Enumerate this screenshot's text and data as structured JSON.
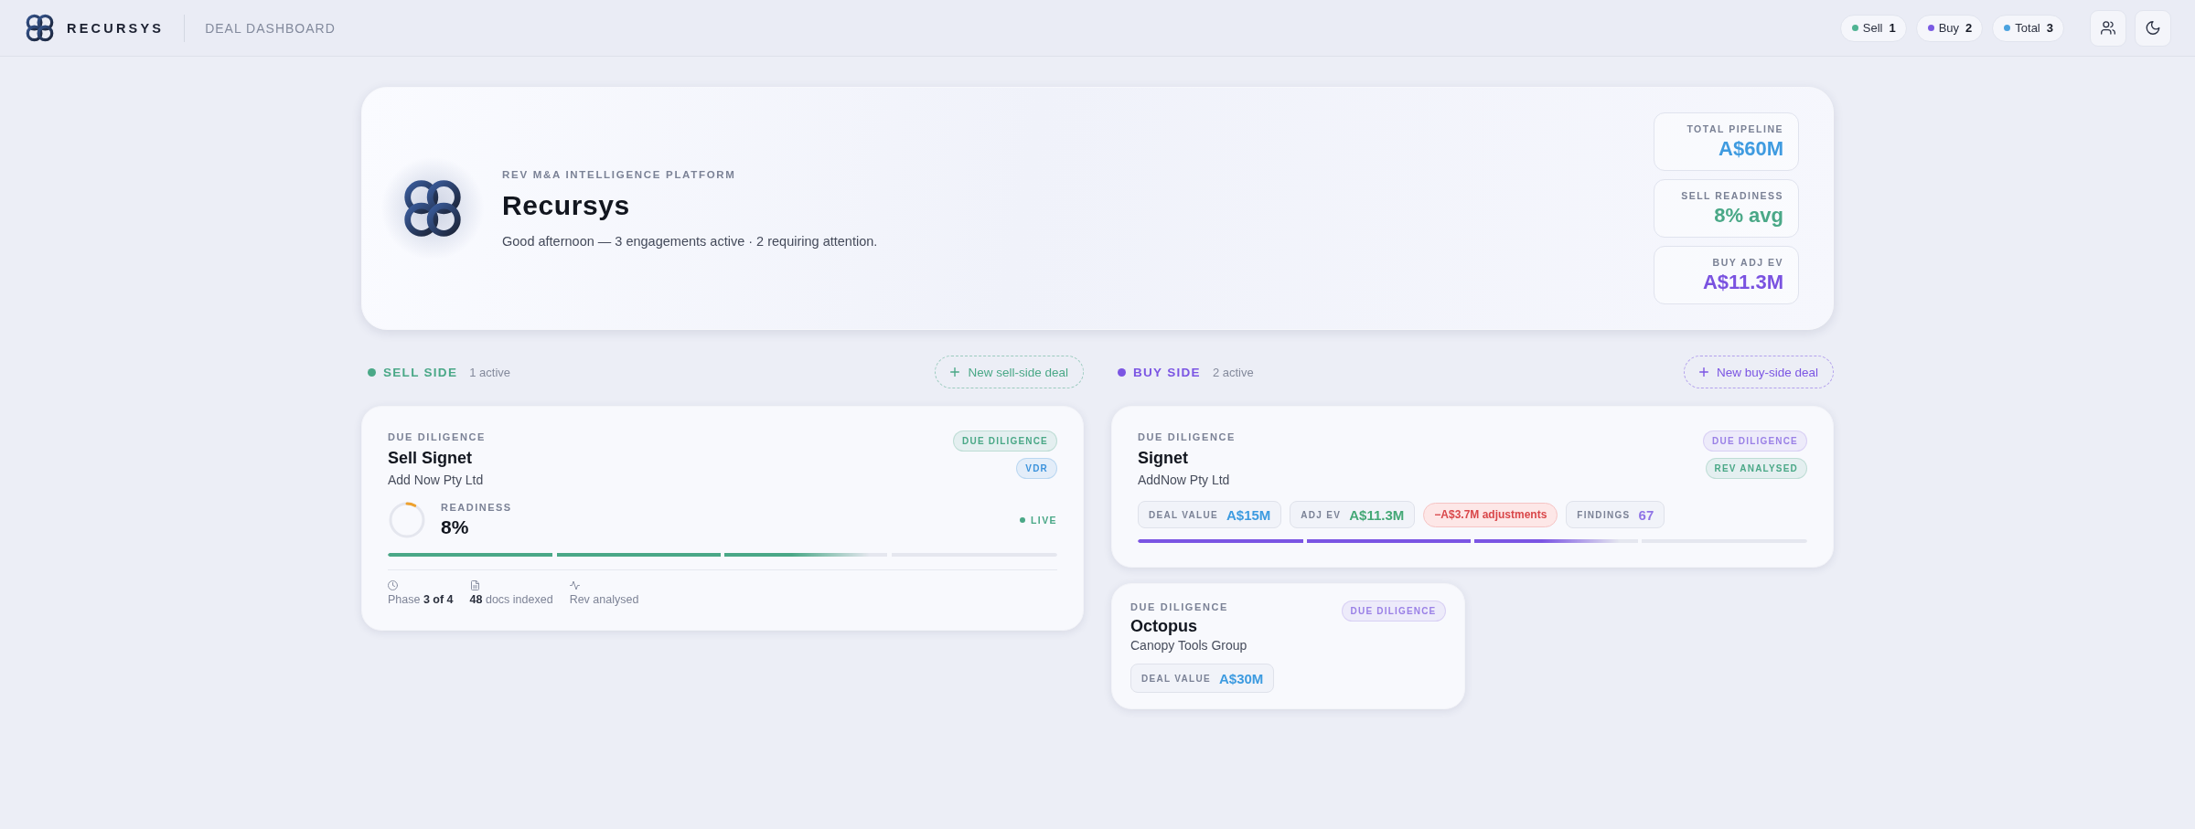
{
  "top_bar": {
    "brand": "RECURSYS",
    "page_title": "DEAL DASHBOARD",
    "counters": [
      {
        "label": "Sell",
        "count": "1",
        "color": "#4fb393"
      },
      {
        "label": "Buy",
        "count": "2",
        "color": "#7a5ae3"
      },
      {
        "label": "Total",
        "count": "3",
        "color": "#4aa2df"
      }
    ]
  },
  "hero": {
    "eyebrow": "REV M&A INTELLIGENCE PLATFORM",
    "title": "Recursys",
    "greeting": "Good afternoon — 3 engagements active · 2 requiring attention.",
    "stats": [
      {
        "label": "TOTAL PIPELINE",
        "value": "A$60M",
        "color": "#3f9be0"
      },
      {
        "label": "SELL READINESS",
        "value": "8% avg",
        "color": "#4aa887"
      },
      {
        "label": "BUY ADJ EV",
        "value": "A$11.3M",
        "color": "#7a52e0"
      }
    ]
  },
  "sections": [
    {
      "title": "SELL SIDE",
      "count": "1 active",
      "color": "#4aa887",
      "new_button": "New sell-side deal",
      "deals": [
        {
          "stage": "DUE DILIGENCE",
          "name": "Sell Signet",
          "company": "Add Now Pty Ltd",
          "badges": [
            {
              "label": "DUE DILIGENCE",
              "color": "#4aa887"
            },
            {
              "label": "VDR",
              "color": "#3d93dc"
            }
          ],
          "readiness": {
            "label": "READINESS",
            "value": "8%",
            "level": 0.08
          },
          "status": "LIVE",
          "progress": {
            "level": 0.72
          },
          "meta": [
            "Phase **3 of 4**",
            "**48** docs indexed",
            "Rev analysed"
          ]
        }
      ]
    },
    {
      "title": "BUY SIDE",
      "count": "2 active",
      "color": "#7b55e3",
      "new_button": "New buy-side deal",
      "deals": [
        {
          "stage": "DUE DILIGENCE",
          "name": "Signet",
          "company": "AddNow Pty Ltd",
          "badges": [
            {
              "label": "DUE DILIGENCE",
              "color": "#9a80e6"
            },
            {
              "label": "REV ANALYSED",
              "color": "#4aa887"
            }
          ],
          "chips": [
            {
              "kind": "metric",
              "label": "DEAL VALUE",
              "value": "A$15M",
              "color": "#3d9be0"
            },
            {
              "kind": "metric",
              "label": "ADJ EV",
              "value": "A$11.3M",
              "color": "#45a877"
            },
            {
              "kind": "alert",
              "text": "−A$3.7M adjustments"
            },
            {
              "kind": "metric",
              "label": "FINDINGS",
              "value": "67",
              "color": "#8f74e6"
            }
          ],
          "progress": {
            "level": 0.72
          }
        },
        {
          "stage": "DUE DILIGENCE",
          "name": "Octopus",
          "company": "Canopy Tools Group",
          "badges": [
            {
              "label": "DUE DILIGENCE",
              "color": "#9a80e6"
            }
          ],
          "chips": [
            {
              "kind": "metric",
              "label": "DEAL VALUE",
              "value": "A$30M",
              "color": "#3d9be0"
            }
          ]
        }
      ]
    }
  ]
}
